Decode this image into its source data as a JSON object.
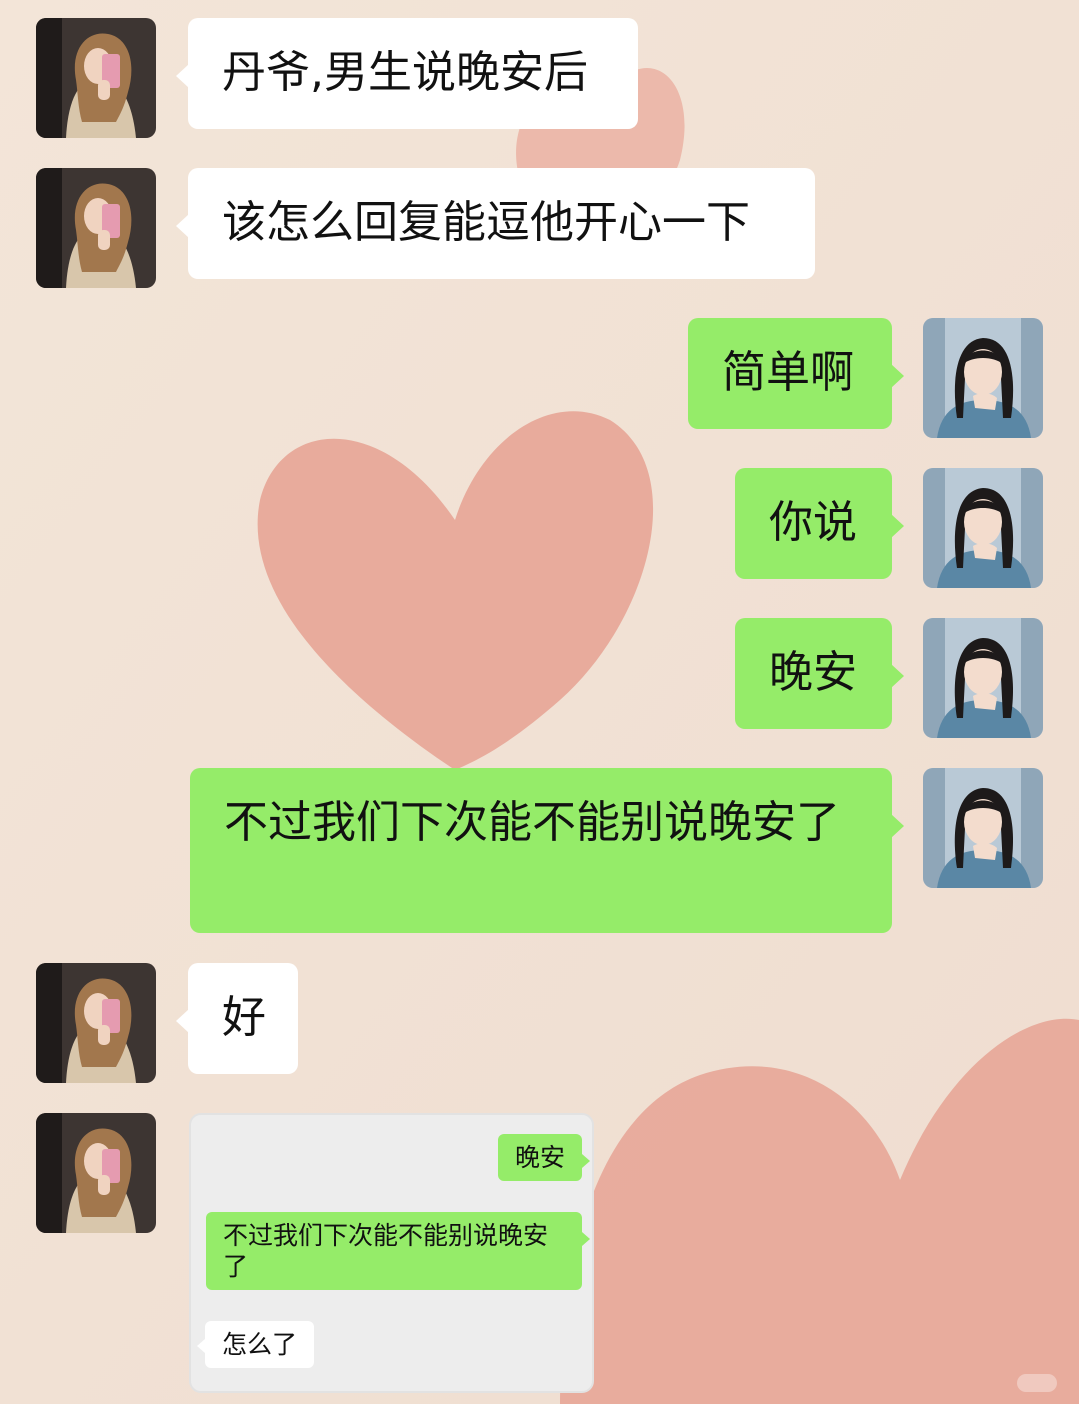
{
  "colors": {
    "background": "#f1e2d4",
    "heart": "#e6a394",
    "bubble_sent": "#95ec69",
    "bubble_received": "#ffffff"
  },
  "messages": [
    {
      "side": "received",
      "avatar": "avatar-girl-phone-selfie",
      "text": "丹爷,男生说晚安后"
    },
    {
      "side": "received",
      "avatar": "avatar-girl-phone-selfie",
      "text": "该怎么回复能逗他开心一下"
    },
    {
      "side": "sent",
      "avatar": "avatar-girl-denim-shirt",
      "text": "简单啊"
    },
    {
      "side": "sent",
      "avatar": "avatar-girl-denim-shirt",
      "text": "你说"
    },
    {
      "side": "sent",
      "avatar": "avatar-girl-denim-shirt",
      "text": "晚安"
    },
    {
      "side": "sent",
      "avatar": "avatar-girl-denim-shirt",
      "text": "不过我们下次能不能别说晚安了"
    },
    {
      "side": "received",
      "avatar": "avatar-girl-phone-selfie",
      "text": "好"
    }
  ],
  "screenshot_message": {
    "items": [
      {
        "side": "sent",
        "text": "晚安"
      },
      {
        "side": "sent",
        "text": "不过我们下次能不能别说晚安了"
      },
      {
        "side": "received",
        "text": "怎么了"
      }
    ]
  }
}
